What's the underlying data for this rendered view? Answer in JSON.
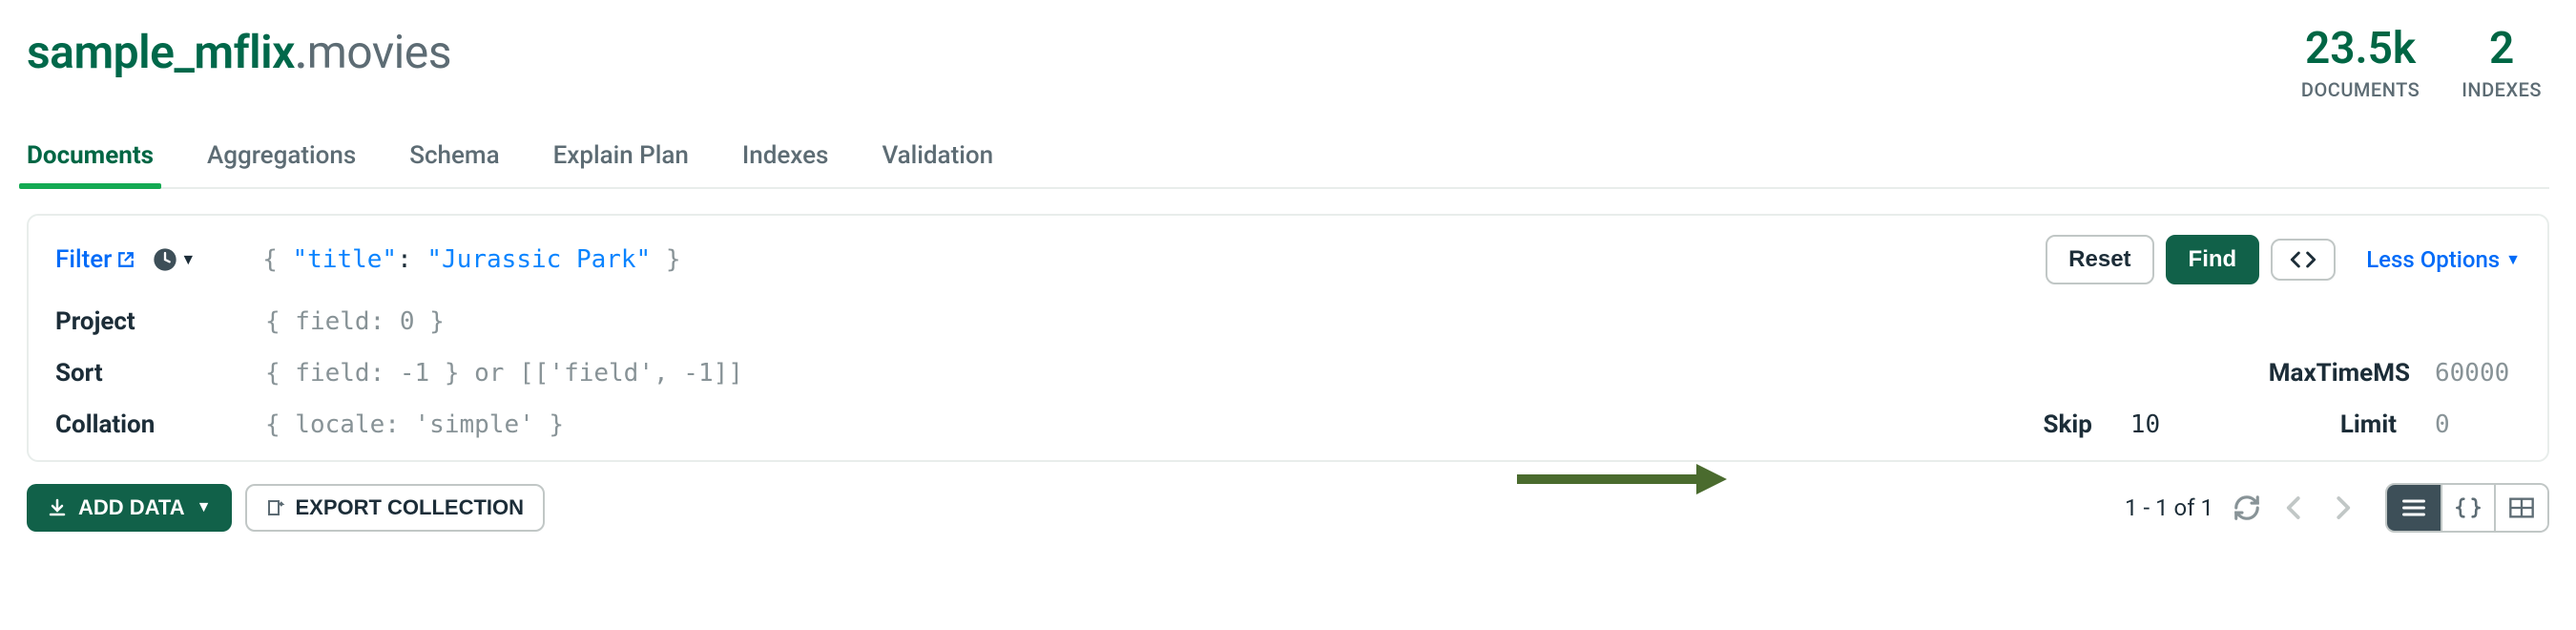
{
  "header": {
    "database": "sample_mflix",
    "collection": "movies",
    "stats": {
      "documents": {
        "value": "23.5k",
        "label": "DOCUMENTS"
      },
      "indexes": {
        "value": "2",
        "label": "INDEXES"
      }
    }
  },
  "tabs": [
    "Documents",
    "Aggregations",
    "Schema",
    "Explain Plan",
    "Indexes",
    "Validation"
  ],
  "activeTab": 0,
  "query": {
    "filterLabel": "Filter",
    "filterValue": "{ \"title\": \"Jurassic Park\" }",
    "filterKey": "\"title\"",
    "filterVal": "\"Jurassic Park\"",
    "resetLabel": "Reset",
    "findLabel": "Find",
    "optionsToggle": "Less Options",
    "project": {
      "label": "Project",
      "placeholder": "{ field: 0 }"
    },
    "sort": {
      "label": "Sort",
      "placeholder": "{ field: -1 } or [['field', -1]]"
    },
    "collation": {
      "label": "Collation",
      "placeholder": "{ locale: 'simple' }"
    },
    "maxTimeMs": {
      "label": "MaxTimeMS",
      "placeholder": "60000"
    },
    "skip": {
      "label": "Skip",
      "value": "10"
    },
    "limit": {
      "label": "Limit",
      "placeholder": "0"
    }
  },
  "toolbar": {
    "addData": "ADD DATA",
    "exportCollection": "EXPORT COLLECTION",
    "pager": "1 - 1 of 1"
  }
}
